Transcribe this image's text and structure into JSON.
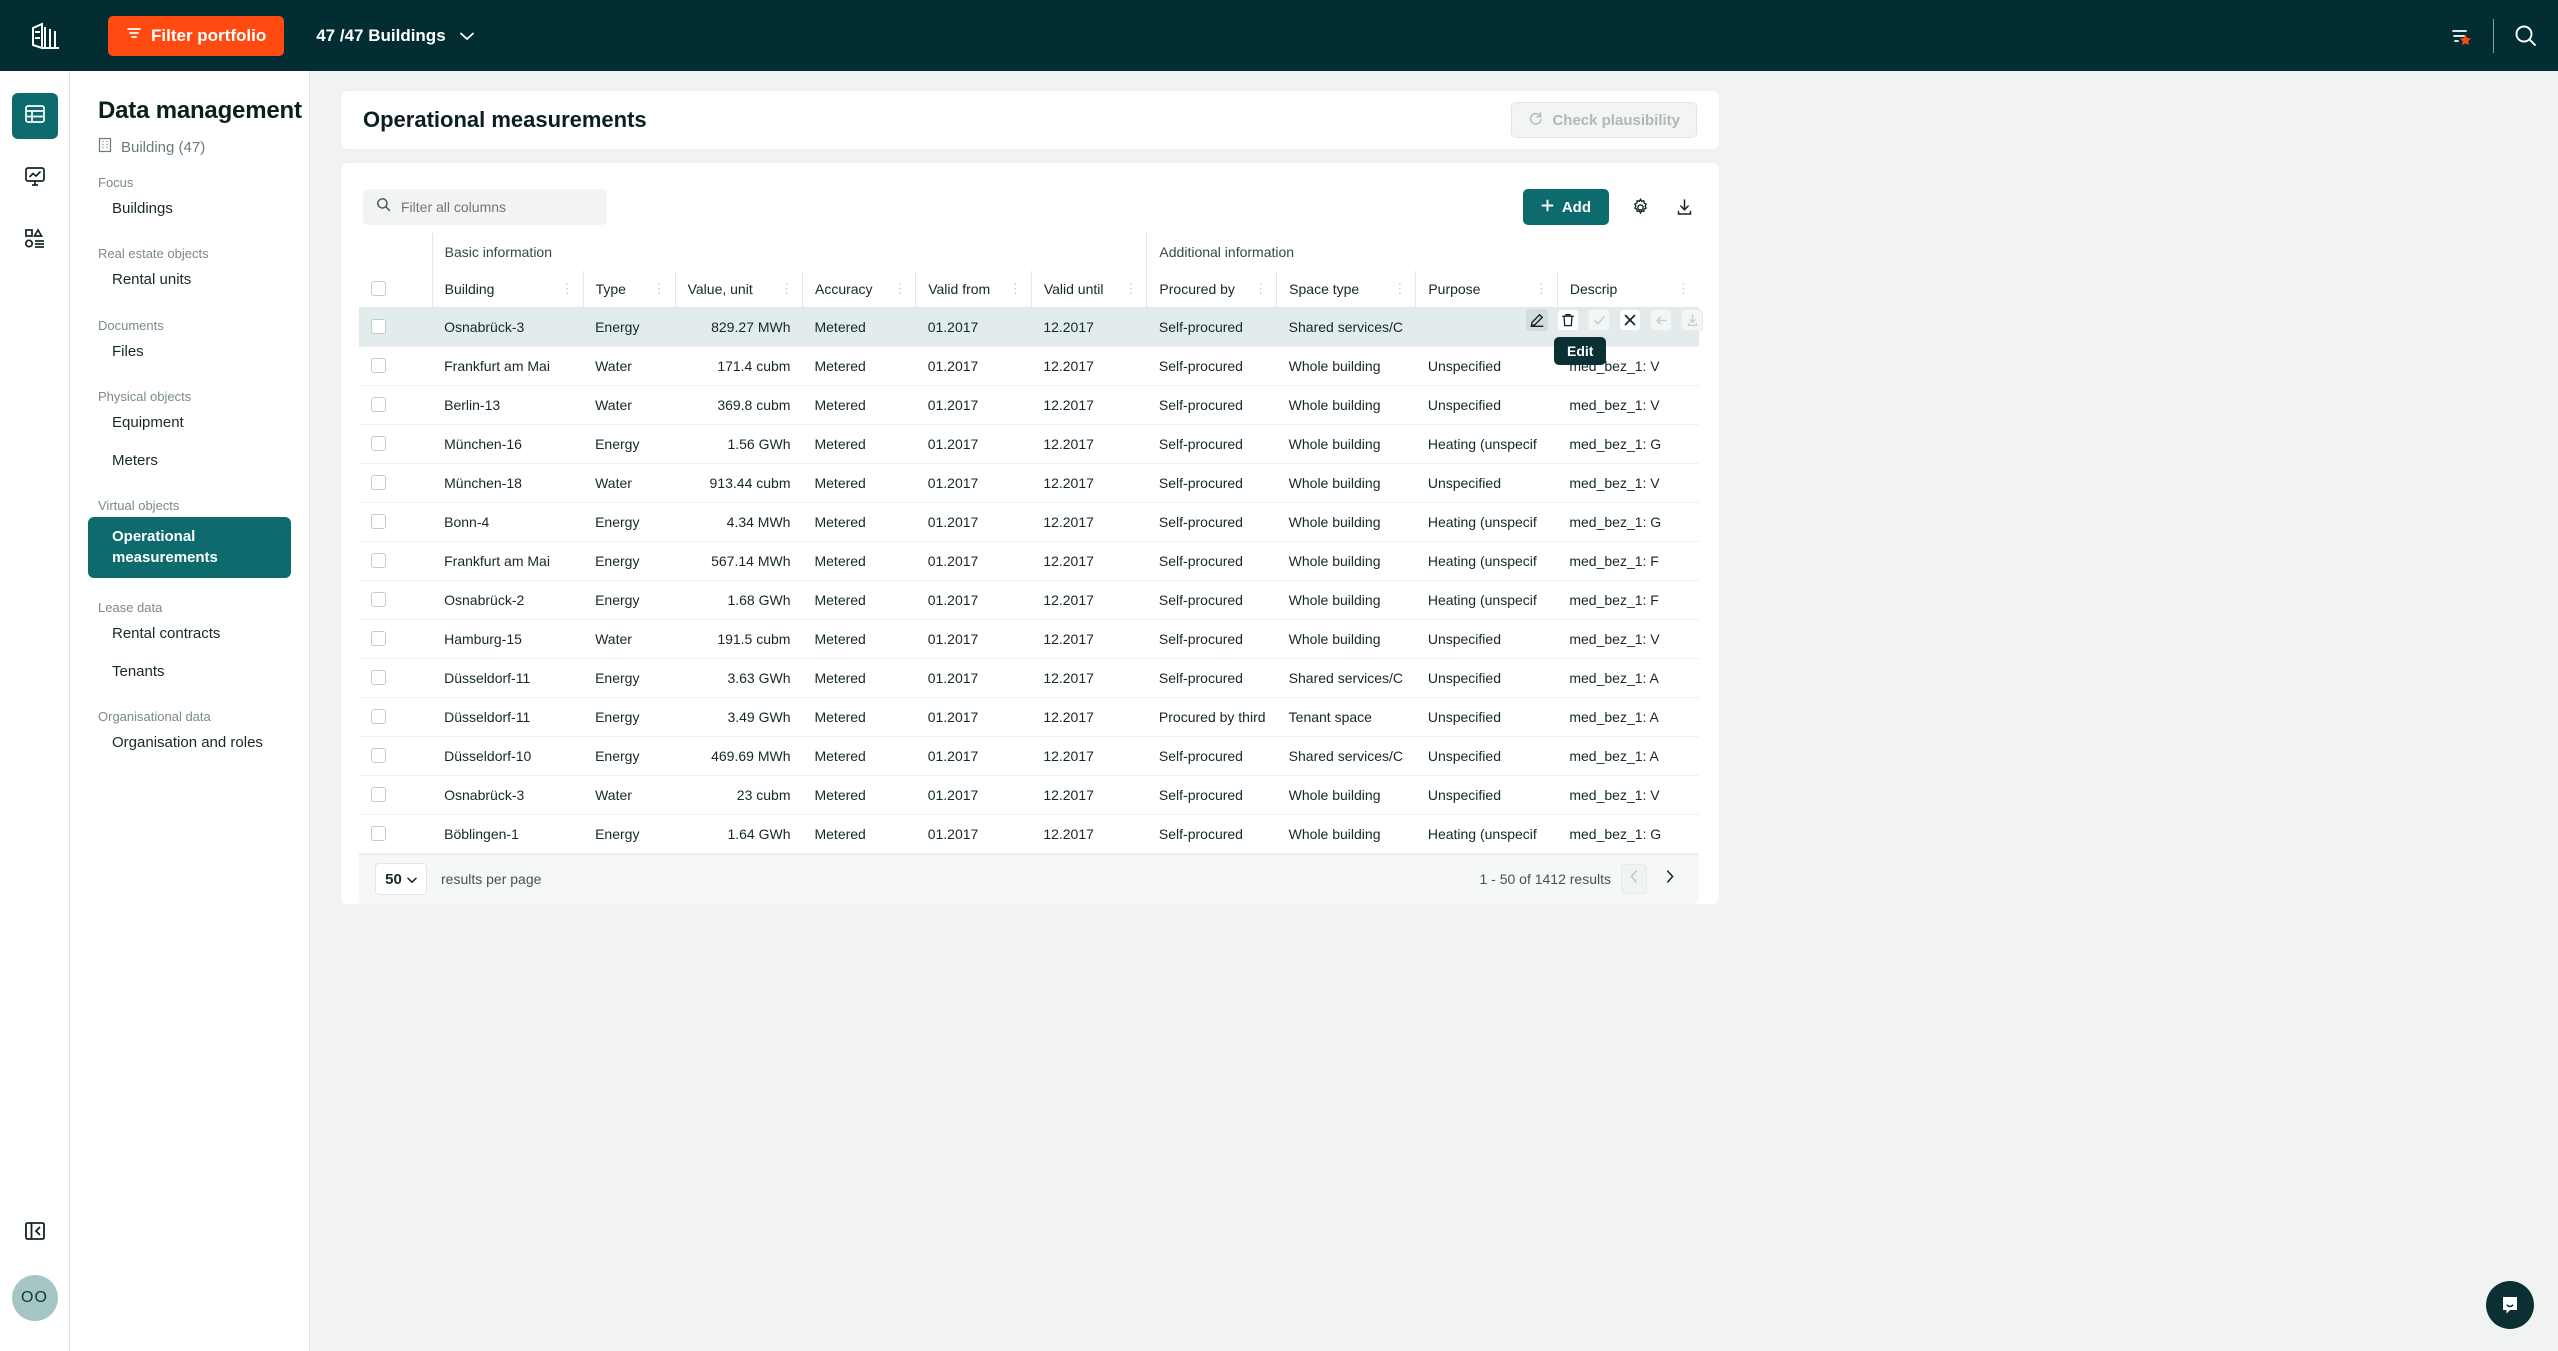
{
  "topbar": {
    "logo_icon": "building-logo-icon",
    "filter_portfolio_label": "Filter portfolio",
    "filter_icon": "filter-lines-icon",
    "buildings_selector": "47 /47 Buildings",
    "chevron_icon": "chevron-down-icon",
    "saved_filter_icon": "filter-star-icon",
    "search_icon": "search-icon",
    "accent_orange": "#ff4b12",
    "bar_color": "#022e33"
  },
  "rail": {
    "items": [
      {
        "name": "table-view",
        "icon": "table-grid-icon",
        "active": true
      },
      {
        "name": "dashboard",
        "icon": "monitor-chart-icon",
        "active": false
      },
      {
        "name": "reports",
        "icon": "shapes-list-icon",
        "active": false
      }
    ],
    "collapse_icon": "collapse-sidebar-icon",
    "avatar_initials": "OO"
  },
  "sidebar": {
    "title": "Data management",
    "subtitle": "Building (47)",
    "subtitle_icon": "building-icon",
    "groups": [
      {
        "label": "Focus",
        "items": [
          {
            "label": "Buildings",
            "active": false
          }
        ]
      },
      {
        "label": "Real estate objects",
        "items": [
          {
            "label": "Rental units",
            "active": false
          }
        ]
      },
      {
        "label": "Documents",
        "items": [
          {
            "label": "Files",
            "active": false
          }
        ]
      },
      {
        "label": "Physical objects",
        "items": [
          {
            "label": "Equipment",
            "active": false
          },
          {
            "label": "Meters",
            "active": false
          }
        ]
      },
      {
        "label": "Virtual objects",
        "items": [
          {
            "label": "Operational measurements",
            "active": true
          }
        ]
      },
      {
        "label": "Lease data",
        "items": [
          {
            "label": "Rental contracts",
            "active": false
          },
          {
            "label": "Tenants",
            "active": false
          }
        ]
      },
      {
        "label": "Organisational data",
        "items": [
          {
            "label": "Organisation and roles",
            "active": false
          }
        ]
      }
    ]
  },
  "page": {
    "title": "Operational measurements",
    "check_plausibility_label": "Check plausibility",
    "check_plausibility_icon": "refresh-icon",
    "check_plausibility_disabled": true
  },
  "toolbar": {
    "search_placeholder": "Filter all columns",
    "search_value": "",
    "search_icon": "search-icon",
    "add_label": "Add",
    "add_icon": "plus-icon",
    "settings_icon": "gear-icon",
    "download_icon": "download-icon",
    "accent_teal": "#0d6b6e"
  },
  "table": {
    "group_headers": [
      {
        "label": "Basic information",
        "span": 6
      },
      {
        "label": "Additional information",
        "span": 4
      }
    ],
    "columns": [
      {
        "key": "building",
        "label": "Building",
        "align": "left"
      },
      {
        "key": "type",
        "label": "Type",
        "align": "left"
      },
      {
        "key": "value",
        "label": "Value, unit",
        "align": "right"
      },
      {
        "key": "accuracy",
        "label": "Accuracy",
        "align": "left"
      },
      {
        "key": "valid_from",
        "label": "Valid from",
        "align": "left"
      },
      {
        "key": "valid_until",
        "label": "Valid until",
        "align": "left"
      },
      {
        "key": "procured_by",
        "label": "Procured by",
        "align": "left"
      },
      {
        "key": "space_type",
        "label": "Space type",
        "align": "left"
      },
      {
        "key": "purpose",
        "label": "Purpose",
        "align": "left"
      },
      {
        "key": "description",
        "label": "Descrip",
        "align": "left"
      }
    ],
    "rows": [
      {
        "selected": true,
        "building": "Osnabrück-3",
        "type": "Energy",
        "value": "829.27 MWh",
        "accuracy": "Metered",
        "valid_from": "01.2017",
        "valid_until": "12.2017",
        "procured_by": "Self-procured",
        "space_type": "Shared services/C",
        "purpose": "",
        "description": ""
      },
      {
        "selected": false,
        "building": "Frankfurt am Mai",
        "type": "Water",
        "value": "171.4 cubm",
        "accuracy": "Metered",
        "valid_from": "01.2017",
        "valid_until": "12.2017",
        "procured_by": "Self-procured",
        "space_type": "Whole building",
        "purpose": "Unspecified",
        "description": "med_bez_1: V"
      },
      {
        "selected": false,
        "building": "Berlin-13",
        "type": "Water",
        "value": "369.8 cubm",
        "accuracy": "Metered",
        "valid_from": "01.2017",
        "valid_until": "12.2017",
        "procured_by": "Self-procured",
        "space_type": "Whole building",
        "purpose": "Unspecified",
        "description": "med_bez_1: V"
      },
      {
        "selected": false,
        "building": "München-16",
        "type": "Energy",
        "value": "1.56 GWh",
        "accuracy": "Metered",
        "valid_from": "01.2017",
        "valid_until": "12.2017",
        "procured_by": "Self-procured",
        "space_type": "Whole building",
        "purpose": "Heating (unspecif",
        "description": "med_bez_1: G"
      },
      {
        "selected": false,
        "building": "München-18",
        "type": "Water",
        "value": "913.44 cubm",
        "accuracy": "Metered",
        "valid_from": "01.2017",
        "valid_until": "12.2017",
        "procured_by": "Self-procured",
        "space_type": "Whole building",
        "purpose": "Unspecified",
        "description": "med_bez_1: V"
      },
      {
        "selected": false,
        "building": "Bonn-4",
        "type": "Energy",
        "value": "4.34 MWh",
        "accuracy": "Metered",
        "valid_from": "01.2017",
        "valid_until": "12.2017",
        "procured_by": "Self-procured",
        "space_type": "Whole building",
        "purpose": "Heating (unspecif",
        "description": "med_bez_1: G"
      },
      {
        "selected": false,
        "building": "Frankfurt am Mai",
        "type": "Energy",
        "value": "567.14 MWh",
        "accuracy": "Metered",
        "valid_from": "01.2017",
        "valid_until": "12.2017",
        "procured_by": "Self-procured",
        "space_type": "Whole building",
        "purpose": "Heating (unspecif",
        "description": "med_bez_1: F"
      },
      {
        "selected": false,
        "building": "Osnabrück-2",
        "type": "Energy",
        "value": "1.68 GWh",
        "accuracy": "Metered",
        "valid_from": "01.2017",
        "valid_until": "12.2017",
        "procured_by": "Self-procured",
        "space_type": "Whole building",
        "purpose": "Heating (unspecif",
        "description": "med_bez_1: F"
      },
      {
        "selected": false,
        "building": "Hamburg-15",
        "type": "Water",
        "value": "191.5 cubm",
        "accuracy": "Metered",
        "valid_from": "01.2017",
        "valid_until": "12.2017",
        "procured_by": "Self-procured",
        "space_type": "Whole building",
        "purpose": "Unspecified",
        "description": "med_bez_1: V"
      },
      {
        "selected": false,
        "building": "Düsseldorf-11",
        "type": "Energy",
        "value": "3.63 GWh",
        "accuracy": "Metered",
        "valid_from": "01.2017",
        "valid_until": "12.2017",
        "procured_by": "Self-procured",
        "space_type": "Shared services/C",
        "purpose": "Unspecified",
        "description": "med_bez_1: A"
      },
      {
        "selected": false,
        "building": "Düsseldorf-11",
        "type": "Energy",
        "value": "3.49 GWh",
        "accuracy": "Metered",
        "valid_from": "01.2017",
        "valid_until": "12.2017",
        "procured_by": "Procured by third",
        "space_type": "Tenant space",
        "purpose": "Unspecified",
        "description": "med_bez_1: A"
      },
      {
        "selected": false,
        "building": "Düsseldorf-10",
        "type": "Energy",
        "value": "469.69 MWh",
        "accuracy": "Metered",
        "valid_from": "01.2017",
        "valid_until": "12.2017",
        "procured_by": "Self-procured",
        "space_type": "Shared services/C",
        "purpose": "Unspecified",
        "description": "med_bez_1: A"
      },
      {
        "selected": false,
        "building": "Osnabrück-3",
        "type": "Water",
        "value": "23 cubm",
        "accuracy": "Metered",
        "valid_from": "01.2017",
        "valid_until": "12.2017",
        "procured_by": "Self-procured",
        "space_type": "Whole building",
        "purpose": "Unspecified",
        "description": "med_bez_1: V"
      },
      {
        "selected": false,
        "building": "Böblingen-1",
        "type": "Energy",
        "value": "1.64 GWh",
        "accuracy": "Metered",
        "valid_from": "01.2017",
        "valid_until": "12.2017",
        "procured_by": "Self-procured",
        "space_type": "Whole building",
        "purpose": "Heating (unspecif",
        "description": "med_bez_1: G"
      }
    ],
    "row_actions": {
      "tooltip_label": "Edit",
      "buttons": [
        {
          "name": "edit-icon",
          "state": "hovered"
        },
        {
          "name": "delete-icon",
          "state": "enabled"
        },
        {
          "name": "confirm-check-icon",
          "state": "disabled"
        },
        {
          "name": "close-x-icon",
          "state": "enabled"
        },
        {
          "name": "undo-arrow-icon",
          "state": "disabled"
        },
        {
          "name": "row-download-icon",
          "state": "disabled"
        }
      ]
    }
  },
  "footer": {
    "per_page_value": "50",
    "per_page_label": "results per page",
    "results_text": "1 - 50 of  1412 results",
    "prev_icon": "chevron-left-icon",
    "next_icon": "chevron-right-icon",
    "prev_disabled": true
  },
  "chat": {
    "icon": "chat-bubble-icon"
  }
}
